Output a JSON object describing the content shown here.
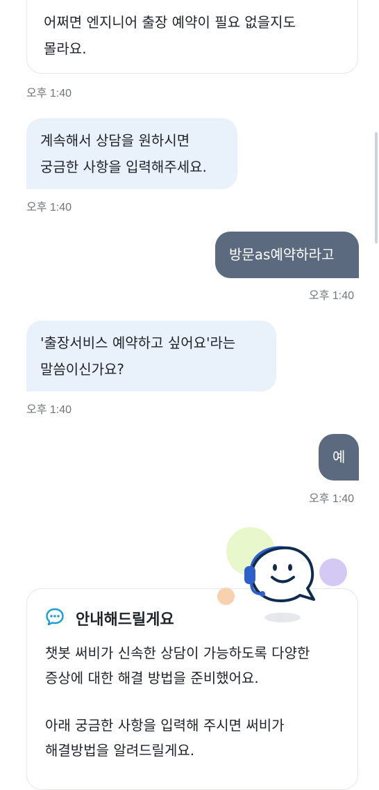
{
  "messages": [
    {
      "role": "bot-card",
      "text": "어쩌면 엔지니어 출장 예약이 필요 없을지도\n몰라요.",
      "time": "오후 1:40"
    },
    {
      "role": "bot",
      "text": "계속해서 상담을 원하시면\n궁금한 사항을 입력해주세요.",
      "time": "오후 1:40"
    },
    {
      "role": "user",
      "text": "방문as예약하라고",
      "time": "오후 1:40"
    },
    {
      "role": "bot",
      "text": "'출장서비스 예약하고 싶어요'라는\n말씀이신가요?",
      "time": "오후 1:40"
    },
    {
      "role": "user",
      "text": "예",
      "time": "오후 1:40"
    }
  ],
  "guide": {
    "icon": "chat-bubble-icon",
    "title": "안내해드릴게요",
    "paragraph1": "챗봇 써비가 신속한 상담이 가능하도록 다양한\n증상에 대한 해결 방법을 준비했어요.",
    "paragraph2": "아래 궁금한 사항을 입력해 주시면 써비가\n해결방법을 알려드릴게요."
  },
  "mascot": {
    "icon": "chatbot-mascot-icon"
  },
  "colors": {
    "bot_bubble": "#e9f1fb",
    "user_bubble": "#5c6a80",
    "timestamp": "#6f747b",
    "accent": "#1a9bd7"
  }
}
